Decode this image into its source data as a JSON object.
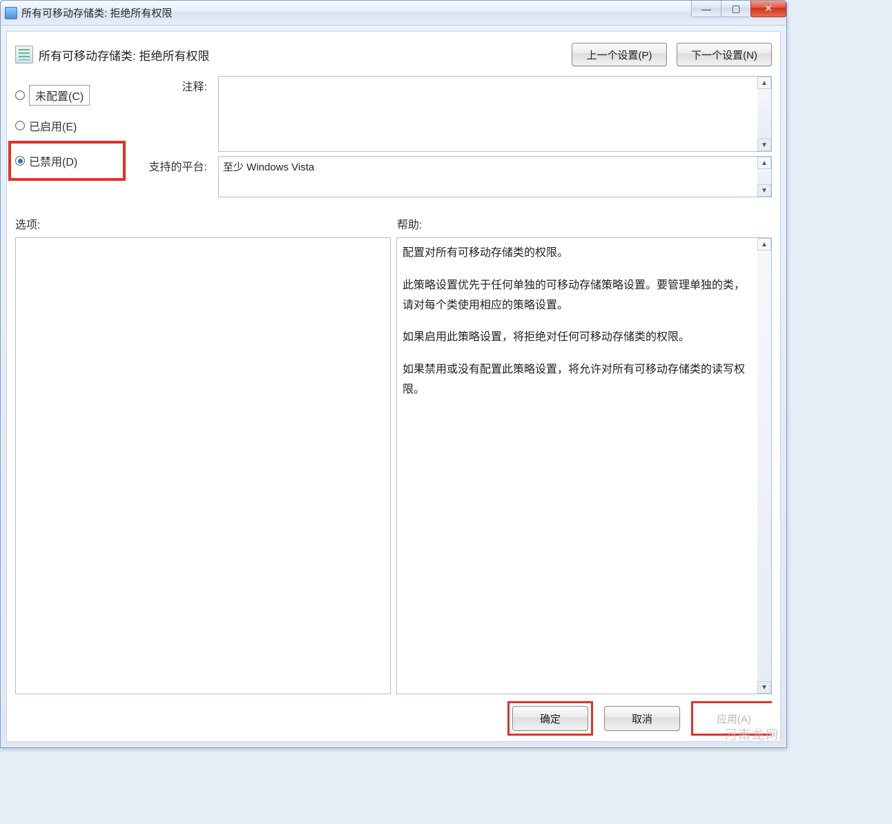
{
  "titlebar": {
    "title": "所有可移动存储类: 拒绝所有权限"
  },
  "window_controls": {
    "minimize": "—",
    "maximize": "▢",
    "close": "✕"
  },
  "header": {
    "policy_title": "所有可移动存储类: 拒绝所有权限",
    "prev_button": "上一个设置(P)",
    "next_button": "下一个设置(N)"
  },
  "radios": {
    "not_configured": "未配置(C)",
    "enabled": "已启用(E)",
    "disabled": "已禁用(D)",
    "selected": "disabled"
  },
  "comment": {
    "label": "注释:",
    "value": ""
  },
  "supported": {
    "label": "支持的平台:",
    "value": "至少 Windows Vista"
  },
  "sections": {
    "options_label": "选项:",
    "help_label": "帮助:"
  },
  "help": {
    "p1": "配置对所有可移动存储类的权限。",
    "p2": "此策略设置优先于任何单独的可移动存储策略设置。要管理单独的类，请对每个类使用相应的策略设置。",
    "p3": "如果启用此策略设置，将拒绝对任何可移动存储类的权限。",
    "p4": "如果禁用或没有配置此策略设置，将允许对所有可移动存储类的读写权限。"
  },
  "footer": {
    "ok": "确定",
    "cancel": "取消",
    "apply": "应用(A)"
  },
  "watermark": "河南龙网"
}
